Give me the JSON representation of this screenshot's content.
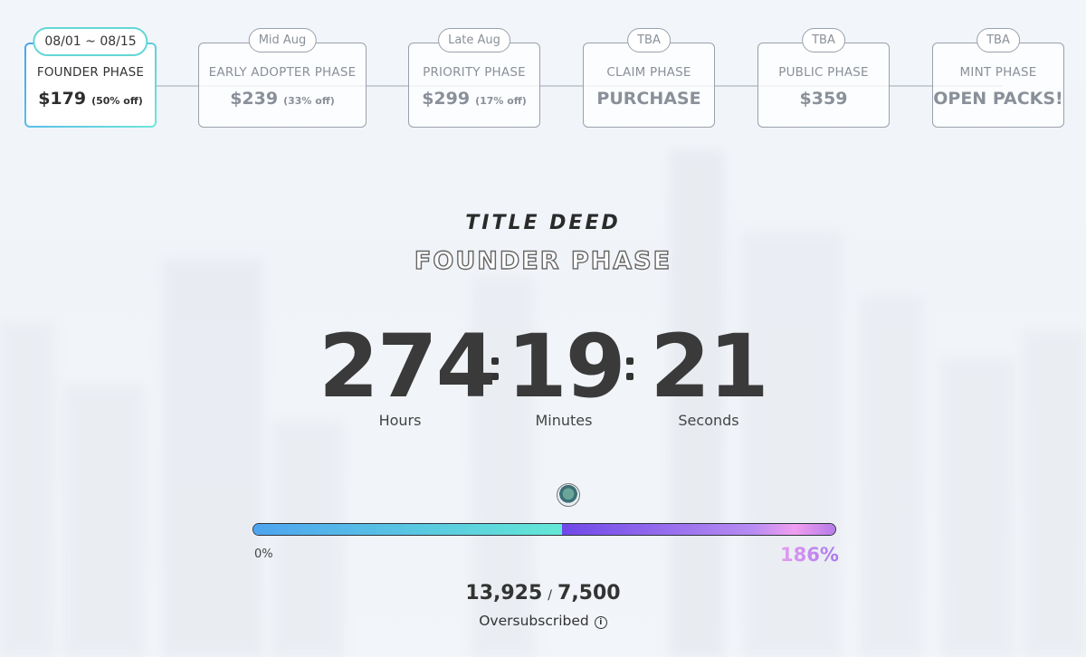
{
  "phases": [
    {
      "tag": "08/01 ~ 08/15",
      "name": "FOUNDER PHASE",
      "price": "$179",
      "discount": "(50% off)",
      "active": true
    },
    {
      "tag": "Mid Aug",
      "name": "EARLY ADOPTER PHASE",
      "price": "$239",
      "discount": "(33% off)",
      "active": false
    },
    {
      "tag": "Late Aug",
      "name": "PRIORITY PHASE",
      "price": "$299",
      "discount": "(17% off)",
      "active": false
    },
    {
      "tag": "TBA",
      "name": "CLAIM PHASE",
      "price": "PURCHASE",
      "discount": "",
      "active": false
    },
    {
      "tag": "TBA",
      "name": "PUBLIC PHASE",
      "price": "$359",
      "discount": "",
      "active": false
    },
    {
      "tag": "TBA",
      "name": "MINT PHASE",
      "price": "OPEN PACKS!",
      "discount": "",
      "active": false
    }
  ],
  "brand": "TITLE DEED",
  "current_phase": "FOUNDER PHASE",
  "countdown": {
    "hours": "274",
    "hours_label": "Hours",
    "minutes": "19",
    "minutes_label": "Minutes",
    "seconds": "21",
    "seconds_label": "Seconds"
  },
  "progress": {
    "start_label": "0%",
    "end_label": "186%",
    "fraction_first_segment": 0.53,
    "sold": "13,925",
    "separator": "/",
    "total": "7,500",
    "status": "Oversubscribed",
    "status_icon": "info-icon"
  },
  "colors": {
    "accent_teal": "#64e8d6",
    "accent_blue": "#4ea4ef",
    "accent_purple": "#a876ef",
    "accent_pink": "#f19ef0"
  }
}
